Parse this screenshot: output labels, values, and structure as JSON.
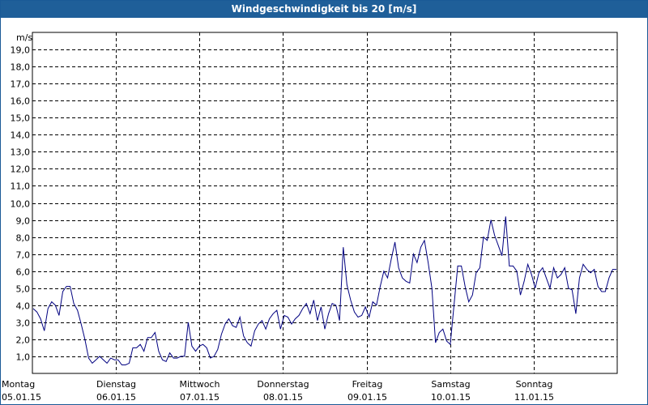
{
  "window": {
    "title": "Windgeschwindigkeit bis 20 [m/s]"
  },
  "chart_data": {
    "type": "line",
    "title": "Windgeschwindigkeit bis 20 [m/s]",
    "ylabel": "m/s",
    "xlabel": "",
    "ylim": [
      0,
      20
    ],
    "xlim": [
      0,
      7
    ],
    "grid": true,
    "line_color": "#000080",
    "y_ticks": [
      "1,0",
      "2,0",
      "3,0",
      "4,0",
      "5,0",
      "6,0",
      "7,0",
      "8,0",
      "9,0",
      "10,0",
      "11,0",
      "12,0",
      "13,0",
      "14,0",
      "15,0",
      "16,0",
      "17,0",
      "18,0",
      "19,0"
    ],
    "x_ticks": [
      {
        "day": "Montag",
        "date": "05.01.15"
      },
      {
        "day": "Dienstag",
        "date": "06.01.15"
      },
      {
        "day": "Mittwoch",
        "date": "07.01.15"
      },
      {
        "day": "Donnerstag",
        "date": "08.01.15"
      },
      {
        "day": "Freitag",
        "date": "09.01.15"
      },
      {
        "day": "Samstag",
        "date": "10.01.15"
      },
      {
        "day": "Sonntag",
        "date": "11.01.15"
      }
    ],
    "series": [
      {
        "values": [
          3.8,
          3.6,
          3.2,
          2.5,
          3.8,
          4.2,
          4.0,
          3.4,
          4.8,
          5.1,
          5.1,
          4.1,
          3.7,
          2.9,
          2.0,
          0.9,
          0.6,
          0.8,
          1.0,
          0.8,
          0.6,
          0.9,
          0.8,
          0.8,
          0.5,
          0.5,
          0.6,
          1.5,
          1.5,
          1.7,
          1.3,
          2.1,
          2.1,
          2.4,
          1.3,
          0.8,
          0.7,
          1.2,
          0.9,
          0.9,
          1.0,
          1.0,
          3.0,
          1.6,
          1.3,
          1.6,
          1.7,
          1.5,
          0.9,
          1.0,
          1.4,
          2.3,
          2.9,
          3.2,
          2.8,
          2.7,
          3.3,
          2.2,
          1.8,
          1.6,
          2.5,
          2.9,
          3.1,
          2.6,
          3.2,
          3.5,
          3.7,
          2.6,
          3.4,
          3.3,
          2.9,
          3.2,
          3.4,
          3.8,
          4.1,
          3.5,
          4.3,
          3.1,
          3.9,
          2.6,
          3.5,
          4.1,
          4.0,
          3.1,
          7.4,
          5.2,
          4.3,
          3.6,
          3.3,
          3.4,
          3.9,
          3.3,
          4.2,
          4.0,
          5.1,
          6.0,
          5.6,
          6.7,
          7.7,
          6.2,
          5.6,
          5.4,
          5.3,
          7.0,
          6.5,
          7.4,
          7.8,
          6.5,
          5.0,
          1.8,
          2.4,
          2.6,
          1.9,
          1.7,
          4.0,
          6.3,
          6.3,
          5.1,
          4.2,
          4.6,
          5.9,
          6.2,
          8.0,
          7.8,
          9.0,
          8.1,
          7.5,
          6.9,
          9.2,
          6.3,
          6.3,
          6.0,
          4.6,
          5.4,
          6.4,
          5.8,
          5.0,
          5.9,
          6.2,
          5.6,
          5.0,
          6.2,
          5.6,
          5.8,
          6.2,
          5.0,
          4.9,
          3.5,
          5.6,
          6.4,
          6.1,
          5.9,
          6.1,
          5.1,
          4.8,
          4.8,
          5.6,
          6.1,
          6.1
        ]
      }
    ]
  }
}
